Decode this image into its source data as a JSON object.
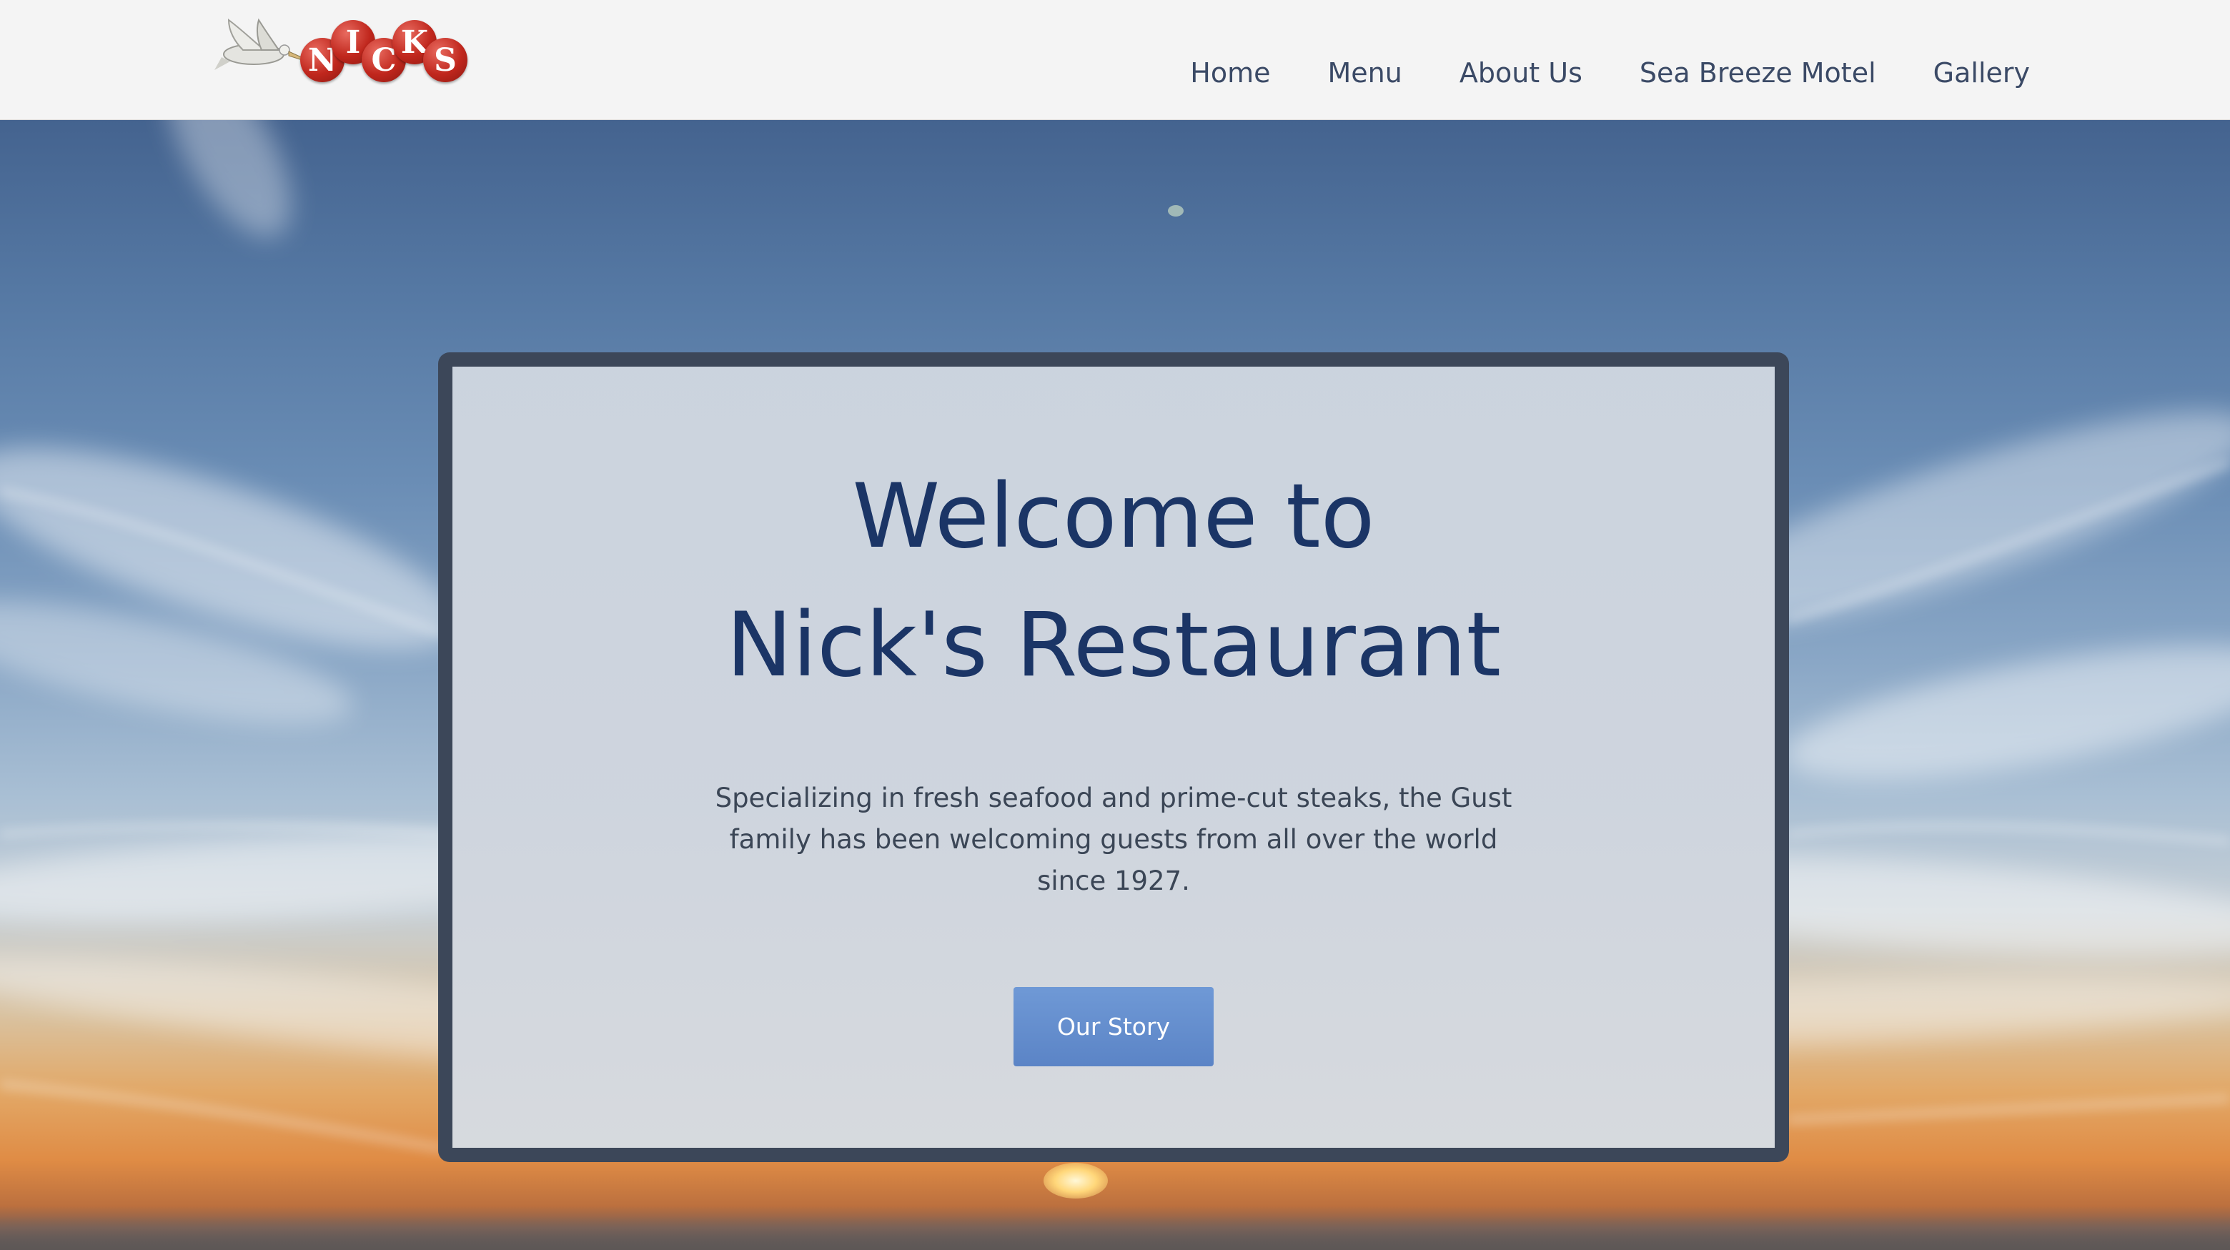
{
  "header": {
    "logo": {
      "text": "NICKS",
      "letters": [
        "N",
        "I",
        "C",
        "K",
        "S"
      ],
      "icon": "pelican-icon"
    },
    "nav": [
      {
        "label": "Home"
      },
      {
        "label": "Menu"
      },
      {
        "label": "About Us"
      },
      {
        "label": "Sea Breeze Motel"
      },
      {
        "label": "Gallery"
      }
    ]
  },
  "hero": {
    "title_line1": "Welcome to",
    "title_line2": "Nick's Restaurant",
    "description": "Specializing in fresh seafood and prime-cut steaks, the Gust family has been welcoming guests from all over the world since 1927.",
    "button_label": "Our Story"
  },
  "colors": {
    "header_bg": "#f4f4f4",
    "nav_text": "#3b4a66",
    "title_text": "#1b3566",
    "card_border": "#3c4759",
    "button_bg": "#6a92d0",
    "logo_red": "#c0271d"
  }
}
